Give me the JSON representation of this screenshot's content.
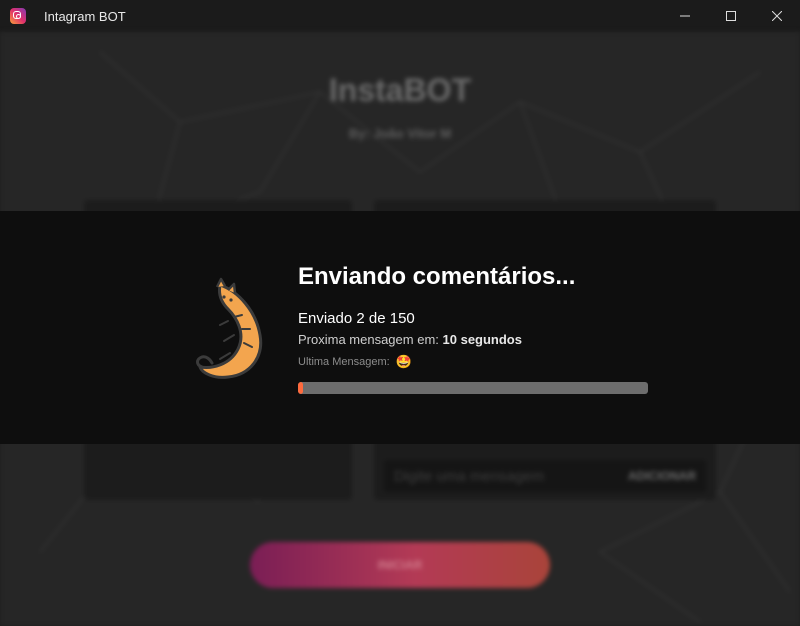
{
  "window": {
    "title": "Intagram BOT",
    "controls": [
      "minimize",
      "maximize",
      "close"
    ]
  },
  "background": {
    "app_title": "InstaBOT",
    "author": "By: João Vitor M",
    "message_input_placeholder": "Digite uma mensagem",
    "add_button_label": "ADICIONAR",
    "start_button_label": "INICIAR"
  },
  "modal": {
    "title": "Enviando comentários...",
    "sent_text": "Enviado 2 de 150",
    "next_label": "Proxima mensagem em:",
    "next_value": "10 segundos",
    "last_label": "Ultima Mensagem:",
    "last_emoji": "🤩",
    "progress_fraction": 0.0133,
    "progress_color": "#ff6a3d",
    "icon": "cat-icon"
  }
}
